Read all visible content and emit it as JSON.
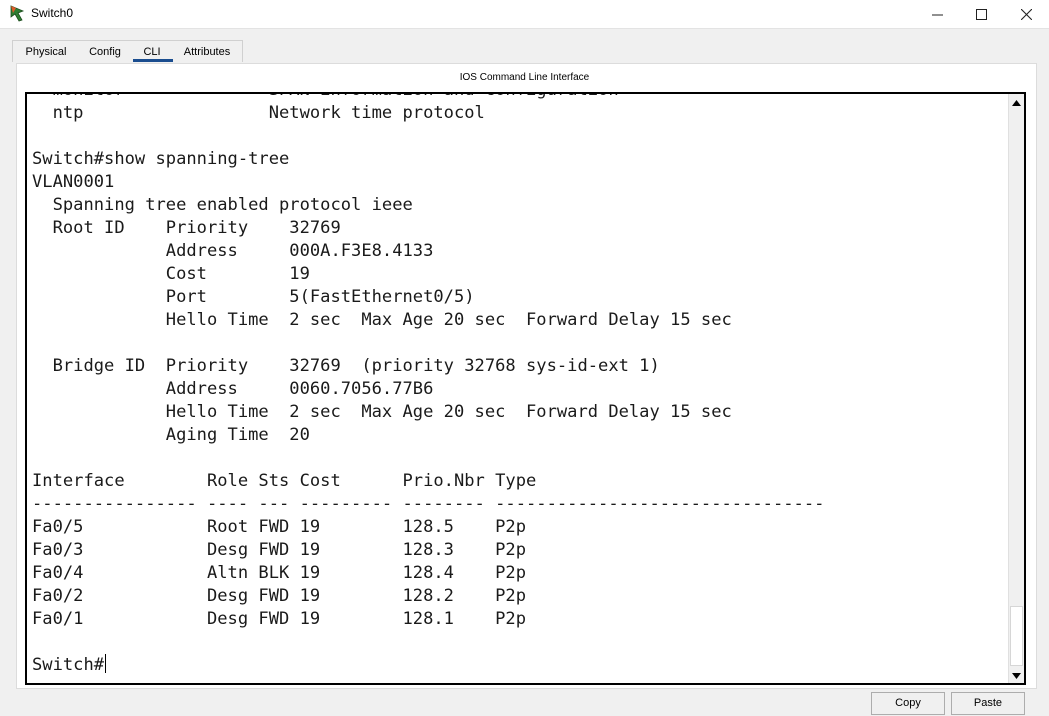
{
  "window": {
    "title": "Switch0",
    "minimize_icon": "minimize-icon",
    "maximize_icon": "maximize-icon",
    "close_icon": "close-icon"
  },
  "tabs": [
    {
      "label": "Physical",
      "active": false
    },
    {
      "label": "Config",
      "active": false
    },
    {
      "label": "CLI",
      "active": true
    },
    {
      "label": "Attributes",
      "active": false
    }
  ],
  "panel": {
    "title": "IOS Command Line Interface"
  },
  "terminal": {
    "lines": [
      "  monitor              SPAN information and configuration",
      "  ntp                  Network time protocol",
      "",
      "Switch#show spanning-tree",
      "VLAN0001",
      "  Spanning tree enabled protocol ieee",
      "  Root ID    Priority    32769",
      "             Address     000A.F3E8.4133",
      "             Cost        19",
      "             Port        5(FastEthernet0/5)",
      "             Hello Time  2 sec  Max Age 20 sec  Forward Delay 15 sec",
      "",
      "  Bridge ID  Priority    32769  (priority 32768 sys-id-ext 1)",
      "             Address     0060.7056.77B6",
      "             Hello Time  2 sec  Max Age 20 sec  Forward Delay 15 sec",
      "             Aging Time  20",
      "",
      "Interface        Role Sts Cost      Prio.Nbr Type",
      "---------------- ---- --- --------- -------- --------------------------------",
      "Fa0/5            Root FWD 19        128.5    P2p",
      "Fa0/3            Desg FWD 19        128.3    P2p",
      "Fa0/4            Altn BLK 19        128.4    P2p",
      "Fa0/2            Desg FWD 19        128.2    P2p",
      "Fa0/1            Desg FWD 19        128.1    P2p",
      ""
    ],
    "prompt": "Switch#"
  },
  "buttons": {
    "copy": "Copy",
    "paste": "Paste"
  },
  "colors": {
    "tab_underline": "#1a4d8f",
    "terminal_bg": "#ffffff",
    "terminal_text": "#1a1a1a"
  }
}
